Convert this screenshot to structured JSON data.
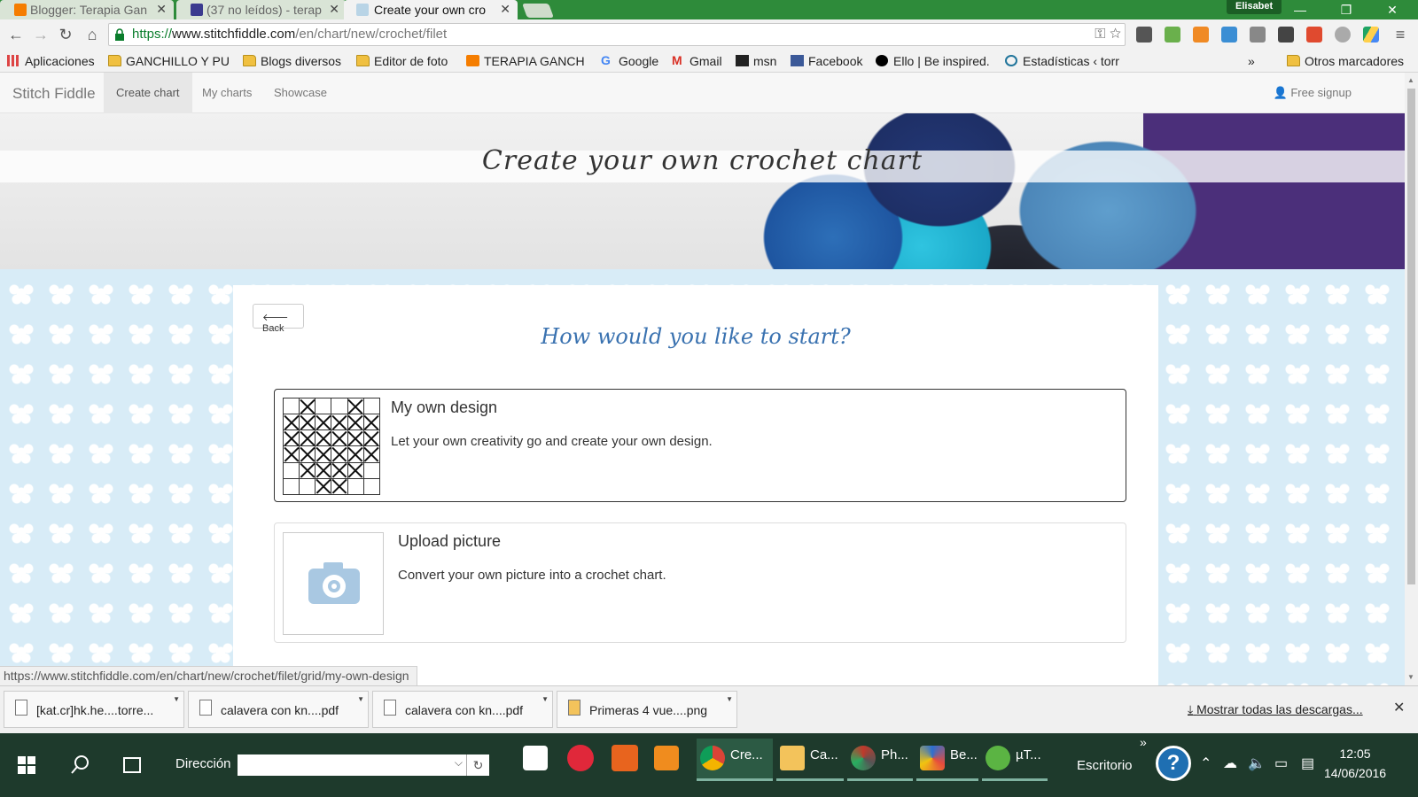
{
  "browser": {
    "tabs": [
      {
        "label": "Blogger: Terapia Gan",
        "icon_color": "#f57d00"
      },
      {
        "label": "(37 no leídos) - terap",
        "icon_color": "#3b3b8f"
      },
      {
        "label": "Create your own cro",
        "icon_color": "#b9d4e6"
      }
    ],
    "profile_name": "Elisabet",
    "url_scheme": "https://",
    "url_host": "www.stitchfiddle.com",
    "url_path": "/en/chart/new/crochet/filet",
    "bookmarks": [
      {
        "label": "Aplicaciones",
        "icon": "apps-grid-icon"
      },
      {
        "label": "GANCHILLO Y PU",
        "icon": "folder-icon"
      },
      {
        "label": "Blogs diversos",
        "icon": "folder-icon"
      },
      {
        "label": "Editor de foto",
        "icon": "folder-icon"
      },
      {
        "label": "TERAPIA GANCH",
        "icon": "blogger-icon"
      },
      {
        "label": "Google",
        "icon": "google-icon"
      },
      {
        "label": "Gmail",
        "icon": "gmail-icon"
      },
      {
        "label": "msn",
        "icon": "msn-icon"
      },
      {
        "label": "Facebook",
        "icon": "facebook-icon"
      },
      {
        "label": "Ello | Be inspired.",
        "icon": "ello-icon"
      },
      {
        "label": "Estadísticas ‹ torr",
        "icon": "wordpress-icon"
      }
    ],
    "bookmarks_overflow": "»",
    "other_bookmarks": "Otros marcadores",
    "status_url": "https://www.stitchfiddle.com/en/chart/new/crochet/filet/grid/my-own-design"
  },
  "site": {
    "brand": "Stitch Fiddle",
    "nav": [
      "Create chart",
      "My charts",
      "Showcase"
    ],
    "signup": "Free signup",
    "hero_title": "Create your own crochet chart",
    "back_label": "Back",
    "question": "How would you like to start?",
    "options": [
      {
        "title": "My own design",
        "description": "Let your own creativity go and create your own design."
      },
      {
        "title": "Upload picture",
        "description": "Convert your own picture into a crochet chart."
      }
    ],
    "design_grid": [
      [
        0,
        1,
        0,
        0,
        1,
        0
      ],
      [
        1,
        1,
        1,
        1,
        1,
        1
      ],
      [
        1,
        1,
        1,
        1,
        1,
        1
      ],
      [
        1,
        1,
        1,
        1,
        1,
        1
      ],
      [
        0,
        1,
        1,
        1,
        1,
        0
      ],
      [
        0,
        0,
        1,
        1,
        0,
        0
      ]
    ]
  },
  "downloads": {
    "items": [
      "[kat.cr]hk.he....torre...",
      "calavera con kn....pdf",
      "calavera con kn....pdf",
      "Primeras 4 vue....png"
    ],
    "show_all": "Mostrar todas las descargas..."
  },
  "taskbar": {
    "address_label": "Dirección",
    "tasks": [
      "Cre...",
      "Ca...",
      "Ph...",
      "Be...",
      "µT..."
    ],
    "overflow": "»",
    "desktop_label": "Escritorio",
    "time": "12:05",
    "date": "14/06/2016"
  },
  "colors": {
    "accent_green": "#2e8b3a",
    "link_blue": "#3a72b0"
  }
}
